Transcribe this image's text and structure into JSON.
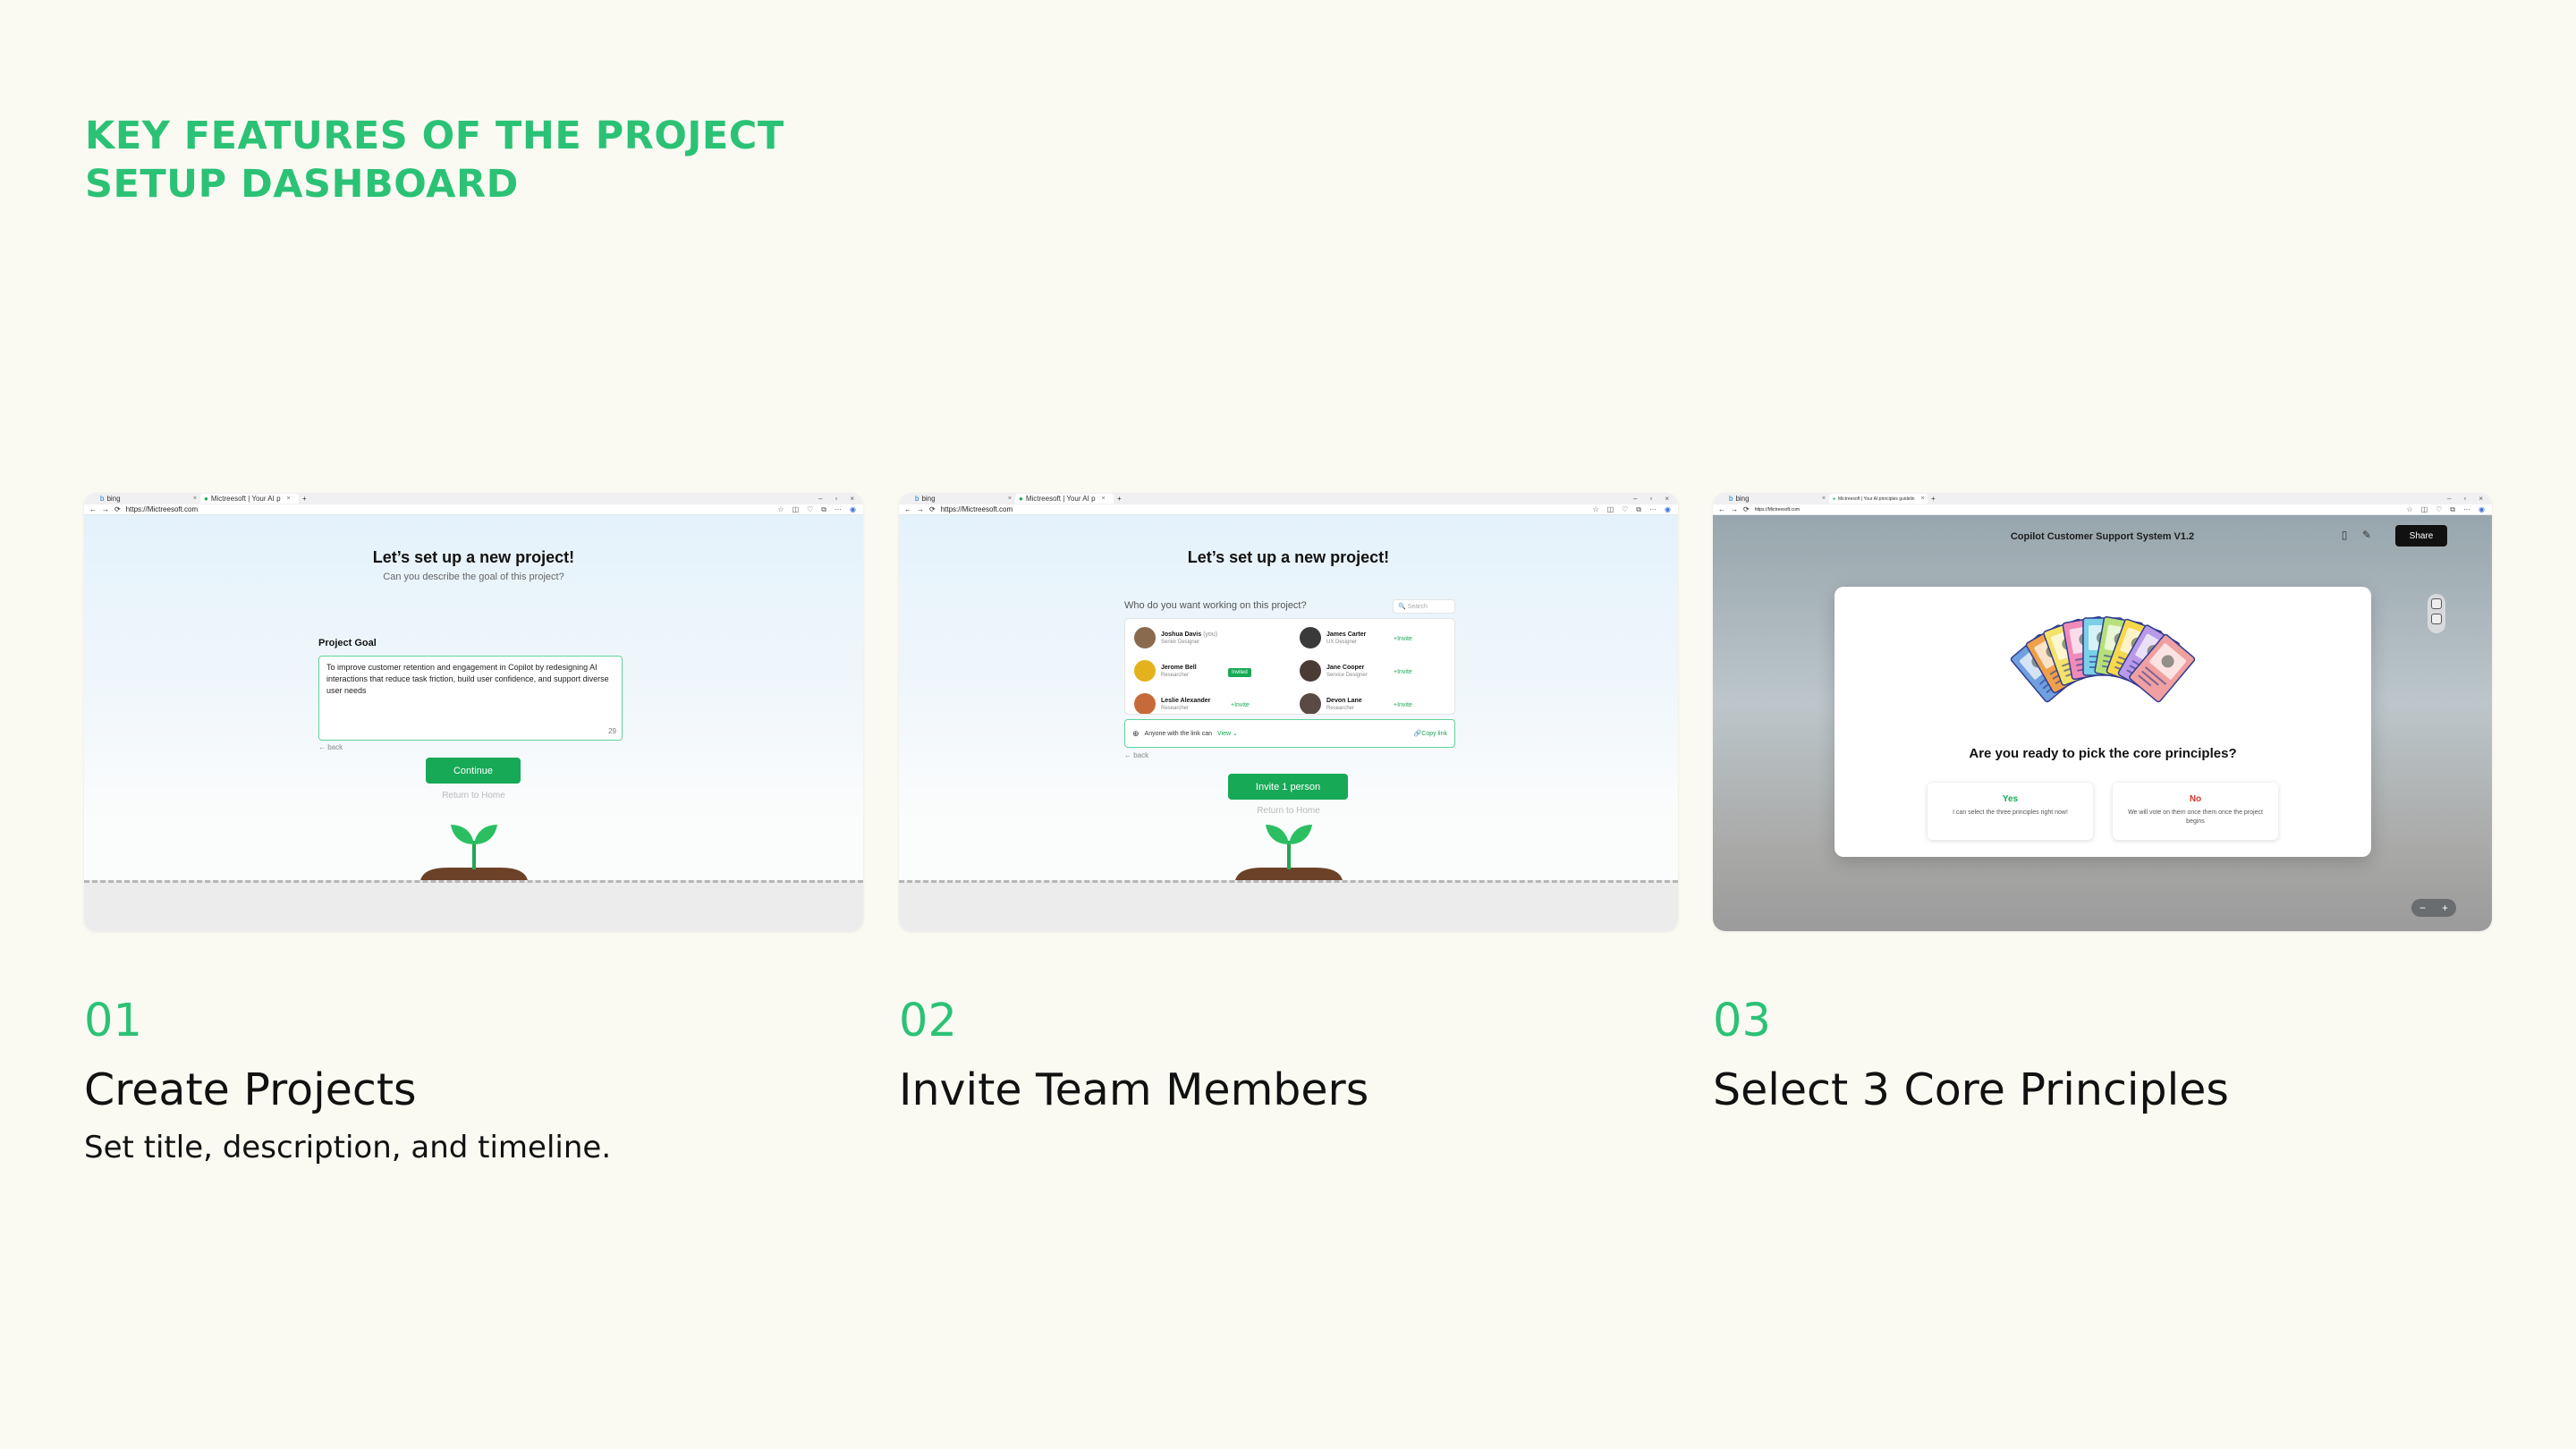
{
  "headline": [
    "KEY FEATURES OF THE PROJECT",
    "SETUP DASHBOARD"
  ],
  "accent_color": "#2bc276",
  "browser": {
    "tab1_label": "bing",
    "tab2_label": "Mictreesoft | Your AI p",
    "tab2_label_short": "Mictreesoft | Your AI principles guidelin",
    "new_tab": "+",
    "close_tab": "×",
    "address": "https://Mictreesoft.com",
    "nav_back": "←",
    "nav_forward": "→",
    "reload": "⟳"
  },
  "features": [
    {
      "number": "01",
      "title": "Create Projects",
      "description": "Set title, description, and timeline."
    },
    {
      "number": "02",
      "title": "Invite Team Members",
      "description": ""
    },
    {
      "number": "03",
      "title": "Select 3 Core Principles",
      "description": ""
    }
  ],
  "screen1": {
    "title": "Let’s set up a new project!",
    "subtitle": "Can you describe the goal of this project?",
    "field_label": "Project Goal",
    "field_value": "To improve customer retention and engagement in Copilot by redesigning AI interactions that reduce task friction, build user confidence, and support diverse user needs",
    "char_count": "29",
    "back_label": "← back",
    "continue_label": "Continue",
    "return_label": "Return to Home"
  },
  "screen2": {
    "title": "Let’s set up a new project!",
    "subtitle": "Who do you want working on this project?",
    "search_placeholder": "🔍 Search",
    "members": [
      {
        "name": "Joshua Davis",
        "tag": "(you)",
        "role": "Senior Designer",
        "action": "",
        "color": "#8a6a4f"
      },
      {
        "name": "James Carter",
        "tag": "",
        "role": "UX Designer",
        "action": "+Invite",
        "color": "#3a3a3a"
      },
      {
        "name": "Jerome Bell",
        "tag": "",
        "role": "Researcher",
        "action": "Invited",
        "color": "#e4b21c"
      },
      {
        "name": "Jane Cooper",
        "tag": "",
        "role": "Service Designer",
        "action": "+Invite",
        "color": "#4a3b34"
      },
      {
        "name": "Leslie Alexander",
        "tag": "",
        "role": "Researcher",
        "action": "+Invite",
        "color": "#c76a3a"
      },
      {
        "name": "Devon Lane",
        "tag": "",
        "role": "Researcher",
        "action": "+Invite",
        "color": "#5a4a44"
      }
    ],
    "share_text": "Anyone with the link can",
    "share_mode": "View",
    "copy_link": "Copy link",
    "back_label": "← back",
    "invite_button": "Invite 1 person",
    "return_label": "Return to Home"
  },
  "screen3": {
    "title": "Copilot Customer Support System V1.2",
    "share_button": "Share",
    "question": "Are you ready to pick the core principles?",
    "yes_label": "Yes",
    "yes_desc": "I can select the three principles right now!",
    "no_label": "No",
    "no_desc": "We will vote on them once them once the project begins",
    "yes_color": "#18a957",
    "no_color": "#d9342b",
    "zoom_out": "−",
    "zoom_in": "+",
    "card_colors": [
      "#6fa0e0",
      "#f0a04a",
      "#f4e36a",
      "#f08ab8",
      "#7ad0e8",
      "#b6e07a",
      "#f7d84a",
      "#b89ae8",
      "#f0a0a0"
    ]
  }
}
